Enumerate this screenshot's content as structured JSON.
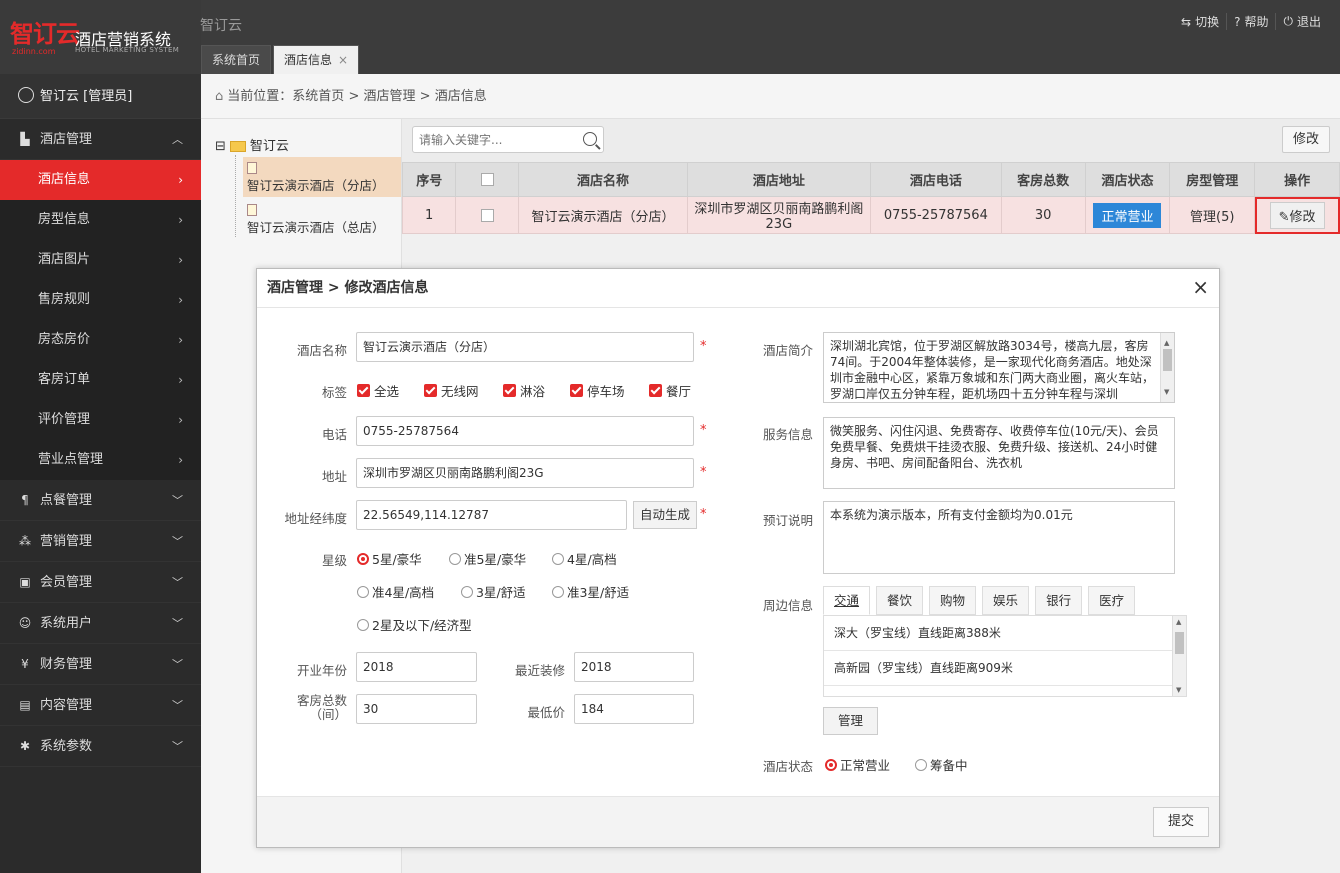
{
  "brand": {
    "logo_text": "智订云",
    "logo_domain": "zidinn.com",
    "system_title": "酒店营销系统",
    "system_title_en": "HOTEL MARKETING SYSTEM"
  },
  "app_name": "智订云",
  "top_actions": [
    {
      "icon": "switch-icon",
      "glyph": "⇆",
      "label": "切换"
    },
    {
      "icon": "help-icon",
      "glyph": "?",
      "label": "帮助"
    },
    {
      "icon": "power-icon",
      "glyph": "⏻",
      "label": "退出"
    }
  ],
  "tabs": [
    {
      "label": "系统首页"
    },
    {
      "label": "酒店信息",
      "close": "×"
    }
  ],
  "sidebar": {
    "user": "智订云 [管理员]",
    "group_hotel": "酒店管理",
    "hotel_items": [
      "酒店信息",
      "房型信息",
      "酒店图片",
      "售房规则",
      "房态房价",
      "客房订单",
      "评价管理",
      "营业点管理"
    ],
    "groups": [
      {
        "label": "点餐管理",
        "icon": "cutlery-icon",
        "glyph": "¶"
      },
      {
        "label": "营销管理",
        "icon": "share-icon",
        "glyph": "⁂"
      },
      {
        "label": "会员管理",
        "icon": "member-card-icon",
        "glyph": "▣"
      },
      {
        "label": "系统用户",
        "icon": "user-icon",
        "glyph": "☺"
      },
      {
        "label": "财务管理",
        "icon": "yen-icon",
        "glyph": "¥"
      },
      {
        "label": "内容管理",
        "icon": "document-icon",
        "glyph": "▤"
      },
      {
        "label": "系统参数",
        "icon": "gear-icon",
        "glyph": "✱"
      }
    ]
  },
  "breadcrumb": {
    "prefix": "当前位置：",
    "items": [
      "系统首页",
      "酒店管理",
      "酒店信息"
    ],
    "sep": ">"
  },
  "tree": {
    "root": "智订云",
    "nodes": [
      "智订云演示酒店（分店）",
      "智订云演示酒店（总店）"
    ]
  },
  "toolbar": {
    "search_placeholder": "请输入关键字...",
    "edit_label": "修改"
  },
  "table": {
    "headers": [
      "序号",
      "",
      "酒店名称",
      "酒店地址",
      "酒店电话",
      "客房总数",
      "酒店状态",
      "房型管理",
      "操作"
    ],
    "row": {
      "index": "1",
      "name": "智订云演示酒店（分店）",
      "address": "深圳市罗湖区贝丽南路鹏利阁23G",
      "phone": "0755-25787564",
      "rooms": "30",
      "status": "正常营业",
      "room_types": "管理(5)",
      "action": "修改"
    }
  },
  "modal": {
    "title": "酒店管理 > 修改酒店信息",
    "close": "×",
    "labels": {
      "name": "酒店名称",
      "tags": "标签",
      "phone": "电话",
      "address": "地址",
      "latlng": "地址经纬度",
      "star": "星级",
      "open_year": "开业年份",
      "renovation": "最近装修",
      "room_total": "客房总数",
      "room_unit": "（间）",
      "min_price": "最低价",
      "intro": "酒店简介",
      "service": "服务信息",
      "booking": "预订说明",
      "nearby": "周边信息",
      "status": "酒店状态"
    },
    "values": {
      "name": "智订云演示酒店（分店）",
      "phone": "0755-25787564",
      "address": "深圳市罗湖区贝丽南路鹏利阁23G",
      "latlng": "22.56549,114.12787",
      "open_year": "2018",
      "renovation": "2018",
      "room_total": "30",
      "min_price": "184",
      "intro": "深圳湖北宾馆，位于罗湖区解放路3034号，楼高九层，客房74间。于2004年整体装修，是一家现代化商务酒店。地处深圳市金融中心区，紧靠万象城和东门两大商业圈，离火车站，罗湖口岸仅五分钟车程，距机场四十五分钟车程与深圳",
      "service": "微笑服务、闪住闪退、免费寄存、收费停车位(10元/天)、会员免费早餐、免费烘干挂烫衣服、免费升级、接送机、24小时健身房、书吧、房间配备阳台、洗衣机",
      "booking": "本系统为演示版本，所有支付金额均为0.01元"
    },
    "required": "*",
    "tags": [
      "全选",
      "无线网",
      "淋浴",
      "停车场",
      "餐厅"
    ],
    "auto_btn": "自动生成",
    "stars": [
      "5星/豪华",
      "准5星/豪华",
      "4星/高档",
      "准4星/高档",
      "3星/舒适",
      "准3星/舒适",
      "2星及以下/经济型"
    ],
    "star_selected": "5星/豪华",
    "nearby_tabs": [
      "交通",
      "餐饮",
      "购物",
      "娱乐",
      "银行",
      "医疗"
    ],
    "nearby_items": [
      "深大（罗宝线）直线距离388米",
      "高新园（罗宝线）直线距离909米"
    ],
    "manage_btn": "管理",
    "status_options": [
      "正常营业",
      "筹备中"
    ],
    "status_selected": "正常营业",
    "submit": "提交"
  },
  "colors": {
    "accent": "#e42a2a",
    "status_blue": "#2d87d8",
    "sidebar": "#2b2b2b",
    "topbar": "#3c3c3c"
  }
}
